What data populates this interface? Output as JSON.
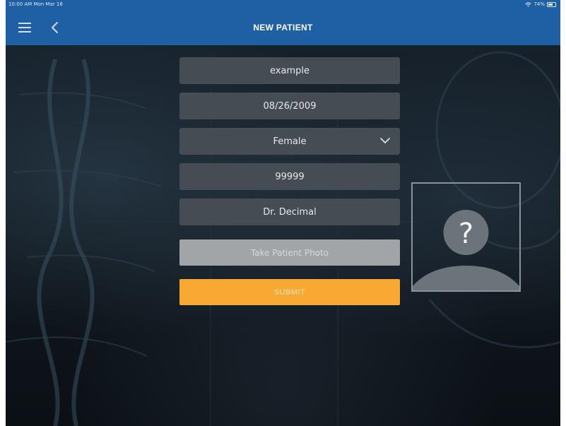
{
  "status_bar": {
    "time_date": "10:00 AM  Mon Mar 16",
    "battery": "74%"
  },
  "header": {
    "title": "NEW PATIENT",
    "menu_icon": "hamburger-menu-icon",
    "back_icon": "chevron-left-icon",
    "color": "#1f5fa3"
  },
  "form": {
    "name_value": "example",
    "dob_value": "08/26/2009",
    "sex_value": "Female",
    "zip_value": "99999",
    "doctor_value": "Dr. Decimal",
    "photo_button_label": "Take Patient Photo",
    "submit_label": "SUBMIT",
    "submit_color": "#f7a933"
  },
  "avatar": {
    "placeholder_glyph": "?",
    "icon": "person-placeholder-icon"
  }
}
